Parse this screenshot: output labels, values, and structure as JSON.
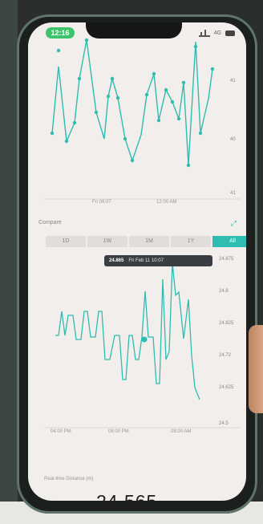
{
  "status_bar": {
    "time": "12:16",
    "network": "4G"
  },
  "top_chart": {
    "y_ticks": [
      "41",
      "40",
      "41"
    ],
    "x_labels": [
      "Fri 09:07",
      "12:00 AM"
    ],
    "color": "#2ebdb0"
  },
  "compare_label": "Compare",
  "range_tabs": {
    "options": [
      "1D",
      "1W",
      "1M",
      "1Y",
      "All"
    ],
    "active_index": 4
  },
  "tooltip": {
    "value": "24.865",
    "time": "Fri Feb 11 10:07"
  },
  "bottom_chart": {
    "y_ticks": [
      "24.875",
      "24.8",
      "24.825",
      "24.72",
      "24.625",
      "24.5"
    ],
    "x_labels": [
      "04:00 PM",
      "08:00 PM",
      "08:00 AM"
    ],
    "color": "#2ebdb0"
  },
  "footer_label": "Real-time Distance (m)",
  "ticker_text": "24.565",
  "colors": {
    "accent": "#2ebdb0",
    "status_pill": "#3cc56a"
  }
}
